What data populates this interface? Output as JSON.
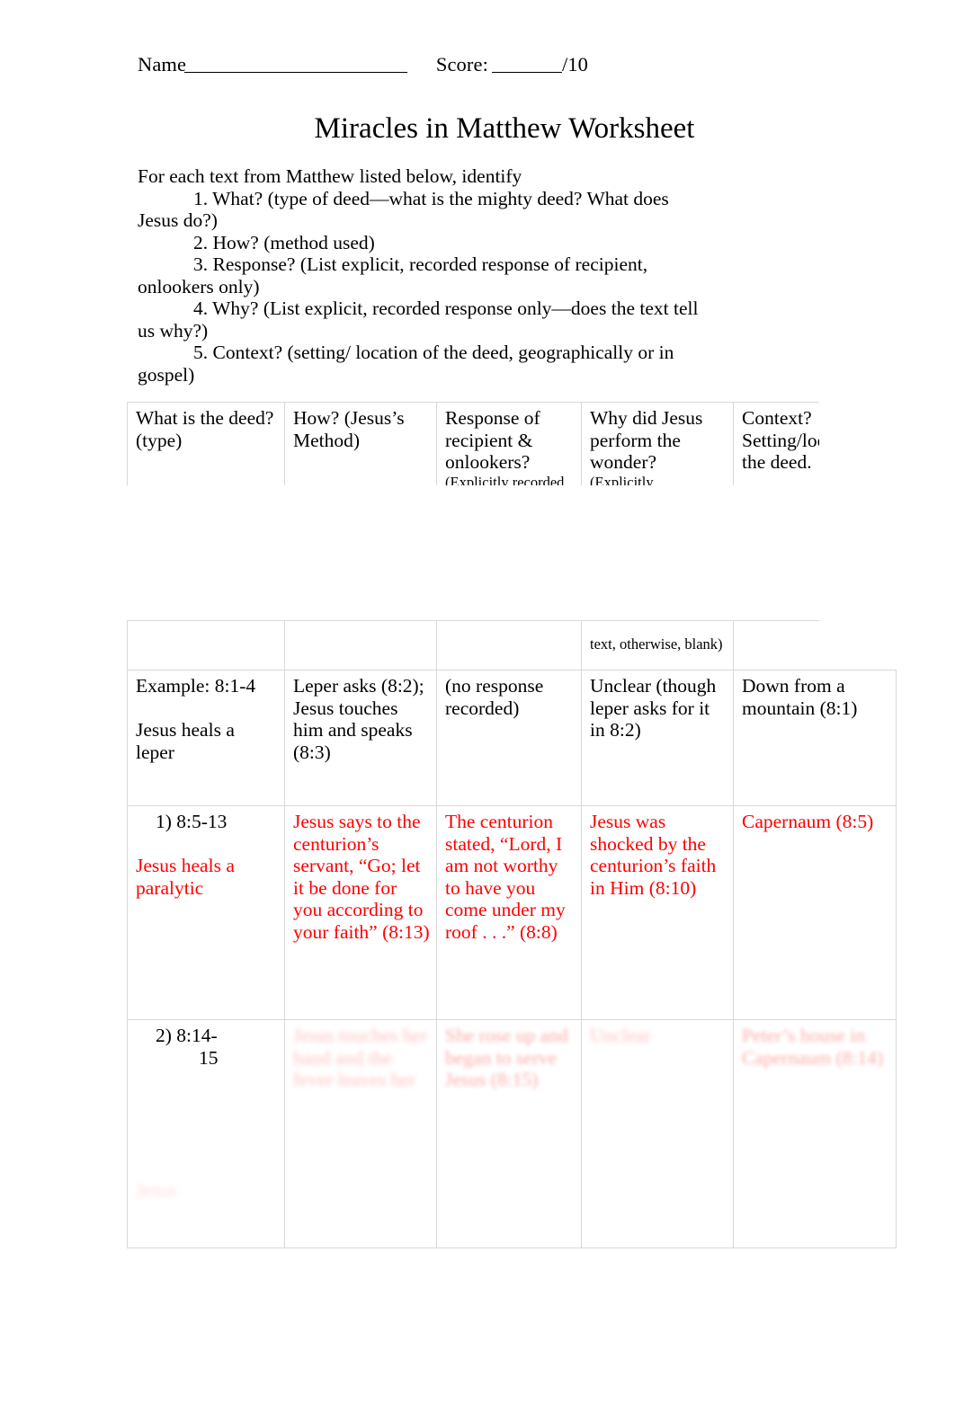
{
  "header": {
    "name_label": "Name",
    "score_label": "Score:",
    "score_total": "/10"
  },
  "title": "Miracles in Matthew Worksheet",
  "instructions": {
    "lead": "For each text from Matthew listed below, identify",
    "items": [
      "1. What? (type of deed—what is the mighty deed? What does Jesus do?)",
      "2. How? (method used)",
      "3. Response? (List explicit, recorded response of recipient, onlookers only)",
      "4. Why? (List explicit, recorded response only—does the text tell us why?)",
      "5. Context? (setting/ location of the deed, geographically or in gospel)"
    ]
  },
  "table": {
    "headers": [
      {
        "main": "What is the deed? (type)",
        "sub": ""
      },
      {
        "main": "How? (Jesus’s Method)",
        "sub": ""
      },
      {
        "main": "Response of recipient & onlookers?",
        "sub": "(Explicitly recorded in"
      },
      {
        "main": "Why did Jesus perform the wonder?",
        "sub": "(Explicitly"
      },
      {
        "main": "Context? Setting/location of the deed.",
        "sub": ""
      }
    ],
    "header_continuation": [
      "",
      "",
      "",
      "text, otherwise, blank)",
      ""
    ],
    "rows": [
      {
        "id": "example",
        "cells": [
          {
            "text": "Example: 8:1-4",
            "text2": "Jesus heals a leper",
            "color": "black"
          },
          {
            "text": "Leper asks (8:2); Jesus touches him and speaks (8:3)",
            "color": "black"
          },
          {
            "text": "(no response recorded)",
            "color": "black"
          },
          {
            "text": "Unclear (though leper asks for it in 8:2)",
            "color": "black"
          },
          {
            "text": "Down from a mountain (8:1)",
            "color": "black"
          }
        ]
      },
      {
        "id": "row-1",
        "cells": [
          {
            "num": "1)  8:5-13",
            "text2": "Jesus heals a paralytic",
            "color": "red"
          },
          {
            "text": "Jesus says to the centurion’s servant, “Go; let it be done for you according to your faith” (8:13)",
            "color": "red"
          },
          {
            "text": "The centurion stated, “Lord, I am not worthy to have you come under my roof . . .” (8:8)",
            "color": "red"
          },
          {
            "text": "Jesus was shocked by the centurion’s faith in Him (8:10)",
            "color": "red"
          },
          {
            "text": "Capernaum (8:5)",
            "color": "red"
          }
        ]
      },
      {
        "id": "row-2",
        "cells": [
          {
            "num": "2)  8:14-",
            "num2": "15",
            "smudge": "Jesus",
            "color": "faded"
          },
          {
            "smudge": "Jesus touches her hand and the fever leaves her",
            "color": "faded"
          },
          {
            "smudge": "She rose up and began to serve Jesus (8:15)",
            "color": "faded"
          },
          {
            "smudge": "Unclear",
            "color": "faded"
          },
          {
            "smudge": "Peter’s house in Capernaum (8:14)",
            "color": "faded"
          }
        ]
      }
    ]
  }
}
